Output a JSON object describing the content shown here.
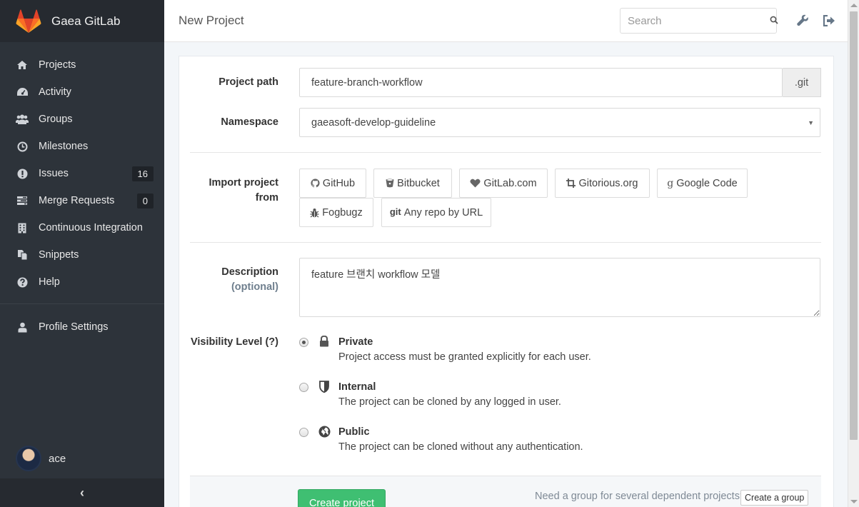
{
  "app": {
    "name": "Gaea GitLab"
  },
  "sidebar": {
    "items": [
      {
        "label": "Projects",
        "icon": "home-icon"
      },
      {
        "label": "Activity",
        "icon": "dashboard-icon"
      },
      {
        "label": "Groups",
        "icon": "group-icon"
      },
      {
        "label": "Milestones",
        "icon": "clock-icon"
      },
      {
        "label": "Issues",
        "icon": "exclamation-icon",
        "count": "16"
      },
      {
        "label": "Merge Requests",
        "icon": "tasks-icon",
        "count": "0"
      },
      {
        "label": "Continuous Integration",
        "icon": "building-icon"
      },
      {
        "label": "Snippets",
        "icon": "copy-icon"
      },
      {
        "label": "Help",
        "icon": "question-icon"
      }
    ],
    "profile_settings": "Profile Settings",
    "user": "ace",
    "collapse_glyph": "‹"
  },
  "header": {
    "title": "New Project",
    "search_placeholder": "Search"
  },
  "form": {
    "project_path": {
      "label": "Project path",
      "value": "feature-branch-workflow",
      "suffix": ".git"
    },
    "namespace": {
      "label": "Namespace",
      "value": "gaeasoft-develop-guideline"
    },
    "import": {
      "label_line1": "Import project",
      "label_line2": "from",
      "sources": [
        "GitHub",
        "Bitbucket",
        "GitLab.com",
        "Gitorious.org",
        "Google Code",
        "Fogbugz",
        "Any repo by URL"
      ],
      "git_prefix": "git"
    },
    "description": {
      "label": "Description",
      "optional": "(optional)",
      "value": "feature 브랜치 workflow 모델"
    },
    "visibility": {
      "label": "Visibility Level (?)",
      "options": [
        {
          "title": "Private",
          "desc": "Project access must be granted explicitly for each user.",
          "selected": true,
          "icon": "lock-icon"
        },
        {
          "title": "Internal",
          "desc": "The project can be cloned by any logged in user.",
          "selected": false,
          "icon": "shield-icon"
        },
        {
          "title": "Public",
          "desc": "The project can be cloned without any authentication.",
          "selected": false,
          "icon": "globe-icon"
        }
      ]
    },
    "create_button": "Create project",
    "group_hint": "Need a group for several dependent projects?",
    "create_group_button": "Create a group"
  },
  "colors": {
    "sidebar_bg": "#2d333a",
    "create_button": "#3fbf72",
    "gitlab_orange": "#e24329"
  }
}
